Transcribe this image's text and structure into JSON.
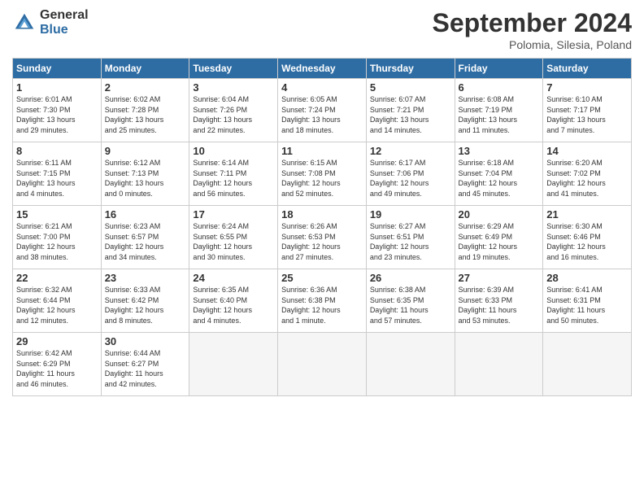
{
  "header": {
    "logo_general": "General",
    "logo_blue": "Blue",
    "month_title": "September 2024",
    "location": "Polomia, Silesia, Poland"
  },
  "weekdays": [
    "Sunday",
    "Monday",
    "Tuesday",
    "Wednesday",
    "Thursday",
    "Friday",
    "Saturday"
  ],
  "weeks": [
    [
      {
        "day": "1",
        "info": "Sunrise: 6:01 AM\nSunset: 7:30 PM\nDaylight: 13 hours\nand 29 minutes."
      },
      {
        "day": "2",
        "info": "Sunrise: 6:02 AM\nSunset: 7:28 PM\nDaylight: 13 hours\nand 25 minutes."
      },
      {
        "day": "3",
        "info": "Sunrise: 6:04 AM\nSunset: 7:26 PM\nDaylight: 13 hours\nand 22 minutes."
      },
      {
        "day": "4",
        "info": "Sunrise: 6:05 AM\nSunset: 7:24 PM\nDaylight: 13 hours\nand 18 minutes."
      },
      {
        "day": "5",
        "info": "Sunrise: 6:07 AM\nSunset: 7:21 PM\nDaylight: 13 hours\nand 14 minutes."
      },
      {
        "day": "6",
        "info": "Sunrise: 6:08 AM\nSunset: 7:19 PM\nDaylight: 13 hours\nand 11 minutes."
      },
      {
        "day": "7",
        "info": "Sunrise: 6:10 AM\nSunset: 7:17 PM\nDaylight: 13 hours\nand 7 minutes."
      }
    ],
    [
      {
        "day": "8",
        "info": "Sunrise: 6:11 AM\nSunset: 7:15 PM\nDaylight: 13 hours\nand 4 minutes."
      },
      {
        "day": "9",
        "info": "Sunrise: 6:12 AM\nSunset: 7:13 PM\nDaylight: 13 hours\nand 0 minutes."
      },
      {
        "day": "10",
        "info": "Sunrise: 6:14 AM\nSunset: 7:11 PM\nDaylight: 12 hours\nand 56 minutes."
      },
      {
        "day": "11",
        "info": "Sunrise: 6:15 AM\nSunset: 7:08 PM\nDaylight: 12 hours\nand 52 minutes."
      },
      {
        "day": "12",
        "info": "Sunrise: 6:17 AM\nSunset: 7:06 PM\nDaylight: 12 hours\nand 49 minutes."
      },
      {
        "day": "13",
        "info": "Sunrise: 6:18 AM\nSunset: 7:04 PM\nDaylight: 12 hours\nand 45 minutes."
      },
      {
        "day": "14",
        "info": "Sunrise: 6:20 AM\nSunset: 7:02 PM\nDaylight: 12 hours\nand 41 minutes."
      }
    ],
    [
      {
        "day": "15",
        "info": "Sunrise: 6:21 AM\nSunset: 7:00 PM\nDaylight: 12 hours\nand 38 minutes."
      },
      {
        "day": "16",
        "info": "Sunrise: 6:23 AM\nSunset: 6:57 PM\nDaylight: 12 hours\nand 34 minutes."
      },
      {
        "day": "17",
        "info": "Sunrise: 6:24 AM\nSunset: 6:55 PM\nDaylight: 12 hours\nand 30 minutes."
      },
      {
        "day": "18",
        "info": "Sunrise: 6:26 AM\nSunset: 6:53 PM\nDaylight: 12 hours\nand 27 minutes."
      },
      {
        "day": "19",
        "info": "Sunrise: 6:27 AM\nSunset: 6:51 PM\nDaylight: 12 hours\nand 23 minutes."
      },
      {
        "day": "20",
        "info": "Sunrise: 6:29 AM\nSunset: 6:49 PM\nDaylight: 12 hours\nand 19 minutes."
      },
      {
        "day": "21",
        "info": "Sunrise: 6:30 AM\nSunset: 6:46 PM\nDaylight: 12 hours\nand 16 minutes."
      }
    ],
    [
      {
        "day": "22",
        "info": "Sunrise: 6:32 AM\nSunset: 6:44 PM\nDaylight: 12 hours\nand 12 minutes."
      },
      {
        "day": "23",
        "info": "Sunrise: 6:33 AM\nSunset: 6:42 PM\nDaylight: 12 hours\nand 8 minutes."
      },
      {
        "day": "24",
        "info": "Sunrise: 6:35 AM\nSunset: 6:40 PM\nDaylight: 12 hours\nand 4 minutes."
      },
      {
        "day": "25",
        "info": "Sunrise: 6:36 AM\nSunset: 6:38 PM\nDaylight: 12 hours\nand 1 minute."
      },
      {
        "day": "26",
        "info": "Sunrise: 6:38 AM\nSunset: 6:35 PM\nDaylight: 11 hours\nand 57 minutes."
      },
      {
        "day": "27",
        "info": "Sunrise: 6:39 AM\nSunset: 6:33 PM\nDaylight: 11 hours\nand 53 minutes."
      },
      {
        "day": "28",
        "info": "Sunrise: 6:41 AM\nSunset: 6:31 PM\nDaylight: 11 hours\nand 50 minutes."
      }
    ],
    [
      {
        "day": "29",
        "info": "Sunrise: 6:42 AM\nSunset: 6:29 PM\nDaylight: 11 hours\nand 46 minutes."
      },
      {
        "day": "30",
        "info": "Sunrise: 6:44 AM\nSunset: 6:27 PM\nDaylight: 11 hours\nand 42 minutes."
      },
      {
        "day": "",
        "info": ""
      },
      {
        "day": "",
        "info": ""
      },
      {
        "day": "",
        "info": ""
      },
      {
        "day": "",
        "info": ""
      },
      {
        "day": "",
        "info": ""
      }
    ]
  ]
}
